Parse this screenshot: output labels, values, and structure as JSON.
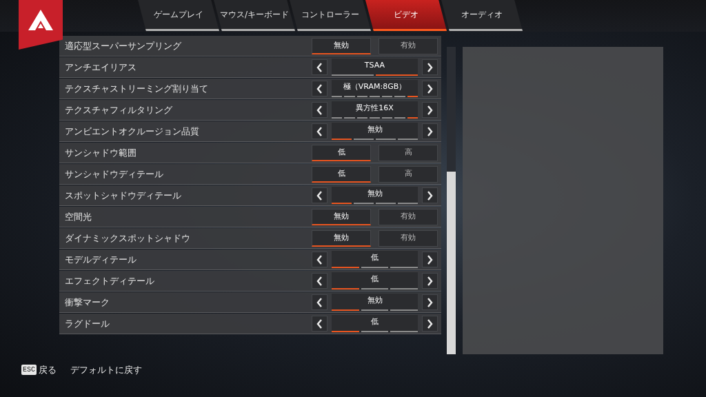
{
  "tabs": [
    {
      "label": "ゲームプレイ",
      "selected": false
    },
    {
      "label": "マウス/キーボード",
      "selected": false
    },
    {
      "label": "コントローラー",
      "selected": false
    },
    {
      "label": "ビデオ",
      "selected": true
    },
    {
      "label": "オーディオ",
      "selected": false
    }
  ],
  "settings": [
    {
      "label": "適応型スーパーサンプリング",
      "kind": "toggle",
      "options": [
        {
          "label": "無効",
          "selected": true
        },
        {
          "label": "有効",
          "selected": false
        }
      ]
    },
    {
      "label": "アンチエイリアス",
      "kind": "cycler",
      "value": "TSAA",
      "segments": [
        {
          "selected": false
        },
        {
          "selected": true
        }
      ]
    },
    {
      "label": "テクスチャストリーミング割り当て",
      "kind": "cycler",
      "value": "極（VRAM:8GB）",
      "segments": [
        {
          "selected": false
        },
        {
          "selected": false
        },
        {
          "selected": false
        },
        {
          "selected": false
        },
        {
          "selected": false
        },
        {
          "selected": false
        },
        {
          "selected": true
        }
      ]
    },
    {
      "label": "テクスチャフィルタリング",
      "kind": "cycler",
      "value": "異方性16X",
      "segments": [
        {
          "selected": false
        },
        {
          "selected": false
        },
        {
          "selected": false
        },
        {
          "selected": false
        },
        {
          "selected": false
        },
        {
          "selected": false
        },
        {
          "selected": true
        }
      ]
    },
    {
      "label": "アンビエントオクルージョン品質",
      "kind": "cycler",
      "value": "無効",
      "segments": [
        {
          "selected": true
        },
        {
          "selected": false
        },
        {
          "selected": false
        },
        {
          "selected": false
        }
      ]
    },
    {
      "label": "サンシャドウ範囲",
      "kind": "toggle",
      "options": [
        {
          "label": "低",
          "selected": true
        },
        {
          "label": "高",
          "selected": false
        }
      ]
    },
    {
      "label": "サンシャドウディテール",
      "kind": "toggle",
      "options": [
        {
          "label": "低",
          "selected": true
        },
        {
          "label": "高",
          "selected": false
        }
      ]
    },
    {
      "label": "スポットシャドウディテール",
      "kind": "cycler",
      "value": "無効",
      "segments": [
        {
          "selected": true
        },
        {
          "selected": false
        },
        {
          "selected": false
        },
        {
          "selected": false
        }
      ]
    },
    {
      "label": "空間光",
      "kind": "toggle",
      "options": [
        {
          "label": "無効",
          "selected": true
        },
        {
          "label": "有効",
          "selected": false
        }
      ]
    },
    {
      "label": "ダイナミックスポットシャドウ",
      "kind": "toggle",
      "options": [
        {
          "label": "無効",
          "selected": true
        },
        {
          "label": "有効",
          "selected": false
        }
      ]
    },
    {
      "label": "モデルディテール",
      "kind": "cycler",
      "value": "低",
      "segments": [
        {
          "selected": true
        },
        {
          "selected": false
        },
        {
          "selected": false
        }
      ]
    },
    {
      "label": "エフェクトディテール",
      "kind": "cycler",
      "value": "低",
      "segments": [
        {
          "selected": true
        },
        {
          "selected": false
        },
        {
          "selected": false
        }
      ]
    },
    {
      "label": "衝撃マーク",
      "kind": "cycler",
      "value": "無効",
      "segments": [
        {
          "selected": true
        },
        {
          "selected": false
        },
        {
          "selected": false
        }
      ]
    },
    {
      "label": "ラグドール",
      "kind": "cycler",
      "value": "低",
      "segments": [
        {
          "selected": true
        },
        {
          "selected": false
        },
        {
          "selected": false
        }
      ]
    }
  ],
  "footer": [
    {
      "key": "ESC",
      "label": "戻る"
    },
    {
      "label": "デフォルトに戻す"
    }
  ]
}
